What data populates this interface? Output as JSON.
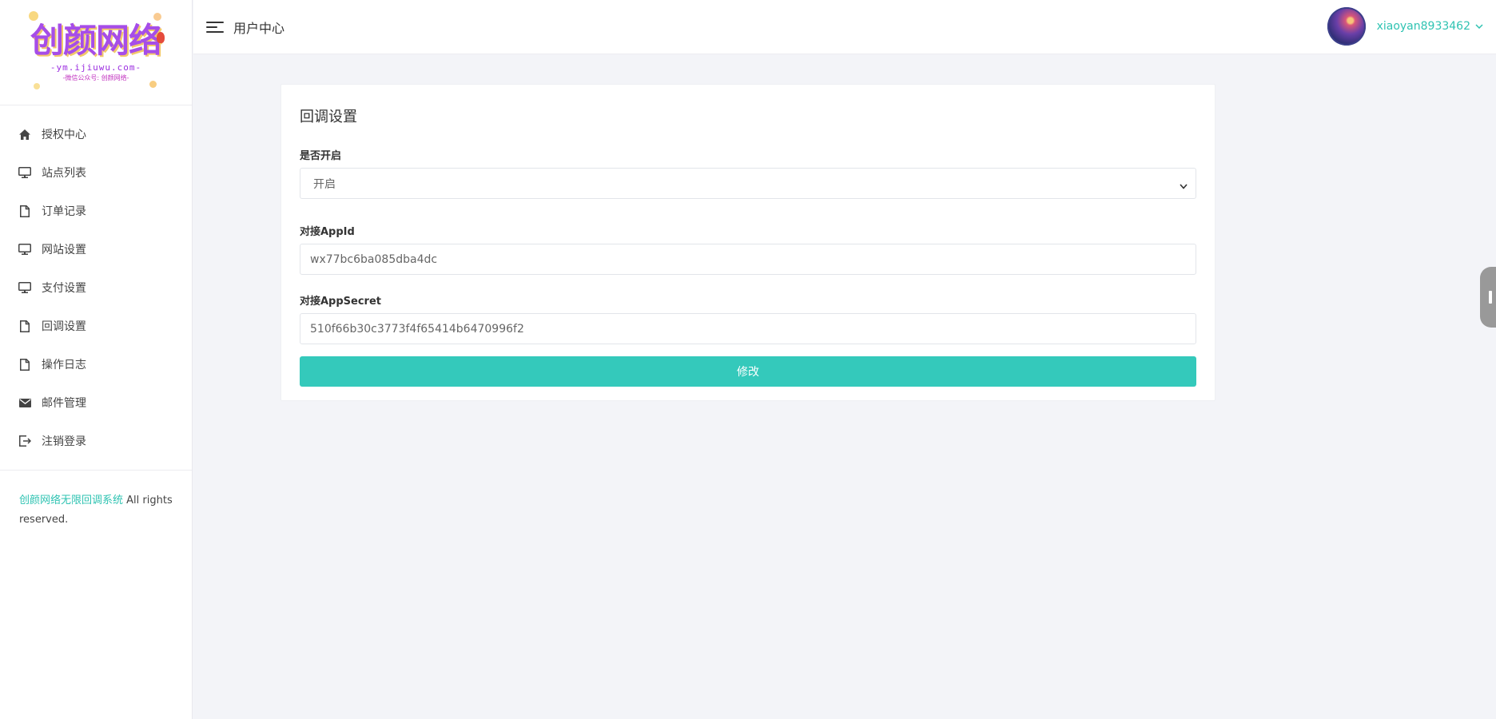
{
  "brand": {
    "logo_title": "创颜网络",
    "logo_domain": "-ym.ijiuwu.com-",
    "logo_tagline": "-微信公众号: 创颜网络-"
  },
  "sidebar": {
    "items": [
      {
        "label": "授权中心",
        "icon": "home-icon"
      },
      {
        "label": "站点列表",
        "icon": "monitor-icon"
      },
      {
        "label": "订单记录",
        "icon": "file-icon"
      },
      {
        "label": "网站设置",
        "icon": "monitor-icon"
      },
      {
        "label": "支付设置",
        "icon": "monitor-icon"
      },
      {
        "label": "回调设置",
        "icon": "file-icon"
      },
      {
        "label": "操作日志",
        "icon": "file-icon"
      },
      {
        "label": "邮件管理",
        "icon": "mail-icon"
      },
      {
        "label": "注销登录",
        "icon": "logout-icon"
      }
    ],
    "footer_link": "创颜网络无限回调系统",
    "footer_text": " All rights reserved."
  },
  "header": {
    "title": "用户中心",
    "username": "xiaoyan8933462"
  },
  "form": {
    "title": "回调设置",
    "enable_label": "是否开启",
    "enable_value": "开启",
    "appid_label": "对接AppId",
    "appid_value": "wx77bc6ba085dba4dc",
    "secret_label": "对接AppSecret",
    "secret_value": "510f66b30c3773f4f65414b6470996f2",
    "submit_label": "修改"
  },
  "colors": {
    "accent": "#34c9bb",
    "link": "#2fc3b2",
    "logo": "#a64de8"
  }
}
